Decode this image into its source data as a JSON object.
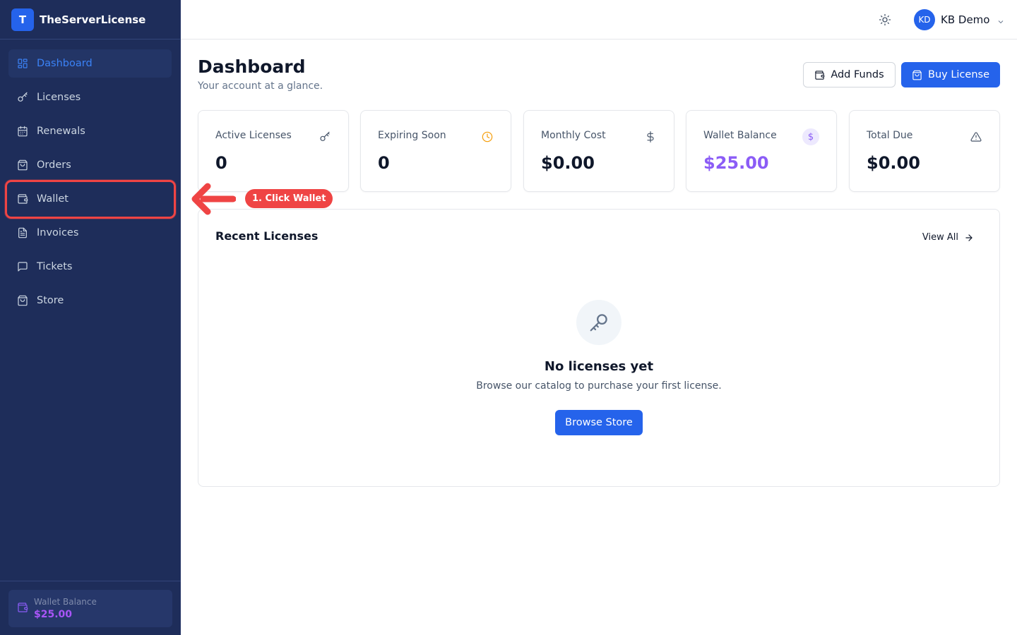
{
  "app": {
    "logo_letter": "T",
    "name": "TheServerLicense"
  },
  "sidebar": {
    "items": [
      {
        "label": "Dashboard",
        "icon": "dashboard-icon",
        "active": true
      },
      {
        "label": "Licenses",
        "icon": "key-icon"
      },
      {
        "label": "Renewals",
        "icon": "calendar-icon"
      },
      {
        "label": "Orders",
        "icon": "shopping-bag-icon"
      },
      {
        "label": "Wallet",
        "icon": "wallet-icon",
        "highlighted": true
      },
      {
        "label": "Invoices",
        "icon": "file-text-icon"
      },
      {
        "label": "Tickets",
        "icon": "message-icon"
      },
      {
        "label": "Store",
        "icon": "store-icon"
      }
    ],
    "footer": {
      "label": "Wallet Balance",
      "value": "$25.00"
    }
  },
  "header": {
    "theme_icon": "sun-icon",
    "user": {
      "initials": "KD",
      "name": "KB Demo"
    }
  },
  "page": {
    "title": "Dashboard",
    "subtitle": "Your account at a glance.",
    "add_funds_label": "Add Funds",
    "buy_license_label": "Buy License"
  },
  "stats": [
    {
      "label": "Active Licenses",
      "value": "0",
      "icon": "key-icon",
      "color": "#475569"
    },
    {
      "label": "Expiring Soon",
      "value": "0",
      "icon": "clock-icon",
      "color": "#f59e0b"
    },
    {
      "label": "Monthly Cost",
      "value": "$0.00",
      "icon": "dollar-icon",
      "color": "#475569"
    },
    {
      "label": "Wallet Balance",
      "value": "$25.00",
      "icon": "dollar-badge-icon",
      "color": "#8b5cf6"
    },
    {
      "label": "Total Due",
      "value": "$0.00",
      "icon": "alert-triangle-icon",
      "color": "#475569"
    }
  ],
  "recent": {
    "title": "Recent Licenses",
    "view_all_label": "View All",
    "empty_title": "No licenses yet",
    "empty_subtitle": "Browse our catalog to purchase your first license.",
    "browse_label": "Browse Store"
  },
  "annotation": {
    "label": "1. Click Wallet",
    "color": "#ef4444"
  }
}
